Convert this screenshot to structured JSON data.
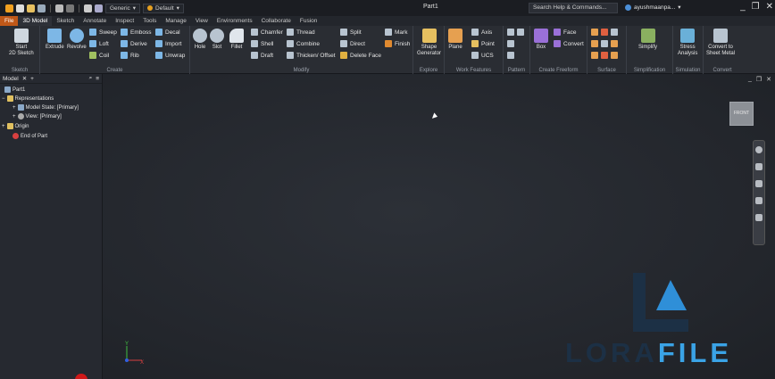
{
  "titlebar": {
    "quick_access": [
      "new-icon",
      "open-icon",
      "save-icon",
      "undo-icon",
      "redo-icon",
      "home-icon",
      "measure-icon"
    ],
    "material_combo": "Generic",
    "appearance_combo": "Default",
    "doc_title": "Part1",
    "search_placeholder": "Search Help & Commands...",
    "user_name": "ayushmaanpa..."
  },
  "tabs": [
    "File",
    "3D Model",
    "Sketch",
    "Annotate",
    "Inspect",
    "Tools",
    "Manage",
    "View",
    "Environments",
    "Collaborate",
    "Fusion"
  ],
  "active_tab": "3D Model",
  "ribbon": {
    "sketch": {
      "label": "Sketch",
      "start": "Start",
      "start2": "2D Sketch"
    },
    "create": {
      "label": "Create",
      "extrude": "Extrude",
      "revolve": "Revolve",
      "sweep": "Sweep",
      "loft": "Loft",
      "coil": "Coil",
      "emboss": "Emboss",
      "derive": "Derive",
      "rib": "Rib",
      "decal": "Decal",
      "import": "Import",
      "unwrap": "Unwrap"
    },
    "modify": {
      "label": "Modify",
      "hole": "Hole",
      "slot": "Slot",
      "fillet": "Fillet",
      "chamfer": "Chamfer",
      "shell": "Shell",
      "draft": "Draft",
      "thread": "Thread",
      "combine": "Combine",
      "thicken": "Thicken/ Offset",
      "split": "Split",
      "direct": "Direct",
      "delete_face": "Delete Face",
      "mark": "Mark",
      "finish": "Finish"
    },
    "explore": {
      "label": "Explore",
      "shape": "Shape",
      "shape2": "Generator"
    },
    "work": {
      "label": "Work Features",
      "plane": "Plane",
      "axis": "Axis",
      "point": "Point",
      "ucs": "UCS"
    },
    "pattern": {
      "label": "Pattern"
    },
    "freeform": {
      "label": "Create Freeform",
      "box": "Box",
      "face": "Face",
      "convert": "Convert"
    },
    "surface": {
      "label": "Surface"
    },
    "simplification": {
      "label": "Simplification",
      "simplify": "Simplify"
    },
    "simulation": {
      "label": "Simulation",
      "stress": "Stress",
      "stress2": "Analysis"
    },
    "convert": {
      "label": "Convert",
      "sheet": "Convert to",
      "sheet2": "Sheet Metal"
    }
  },
  "browser": {
    "tab": "Model",
    "items": [
      "Part1",
      "Representations",
      "Model State: [Primary]",
      "View: [Primary]",
      "Origin",
      "End of Part"
    ]
  },
  "viewcube_label": "FRONT",
  "triad": {
    "y": "Y",
    "x": "X"
  },
  "watermark": {
    "a": "LORA",
    "b": "FILE"
  },
  "colors": {
    "accent": "#3aa3e6",
    "file_tab": "#c05818",
    "brand_dark": "#1c3045"
  }
}
